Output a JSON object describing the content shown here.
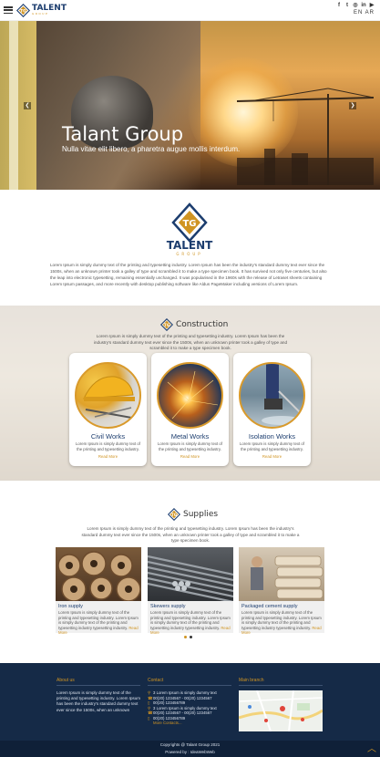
{
  "header": {
    "brand": "TALENT",
    "brand_sub": "GROUP",
    "social_icons": [
      "facebook-icon",
      "twitter-icon",
      "instagram-icon",
      "linkedin-icon",
      "youtube-icon"
    ],
    "languages": [
      "EN",
      "AR"
    ]
  },
  "hero": {
    "title": "Talant Group",
    "subtitle": "Nulla vitae elit libero, a pharetra augue mollis interdum."
  },
  "about": {
    "brand": "TALENT",
    "brand_sub": "GROUP",
    "text": "Lorem Ipsum is simply dummy text of the printing and typesetting industry. Lorem Ipsum has been the industry's standard dummy text ever since the 1500s, when an unknown printer took a galley of type and scrambled it to make a type specimen book. It has survived not only five centuries, but also the leap into electronic typesetting, remaining essentially unchanged. It was popularised in the 1960s with the release of Letraset sheets containing Lorem Ipsum passages, and more recently with desktop publishing software like Aldus PageMaker including versions of Lorem Ipsum."
  },
  "construction": {
    "title": "Construction",
    "desc": "Lorem Ipsum is simply dummy text of the printing and typesetting industry. Lorem Ipsum has been the industry's standard dummy text ever since the 1500s, when an unknown printer took a galley of type and scrambled it to make a type specimen book.",
    "cards": [
      {
        "title": "Civil Works",
        "desc": "Lorem Ipsum is simply dummy text of the printing and typesetting industry.",
        "more": "Read More"
      },
      {
        "title": "Metal Works",
        "desc": "Lorem Ipsum is simply dummy text of the printing and typesetting industry.",
        "more": "Read More"
      },
      {
        "title": "Isolation Works",
        "desc": "Lorem Ipsum is simply dummy text of the printing and typesetting industry.",
        "more": "Read More"
      }
    ]
  },
  "supplies": {
    "title": "Supplies",
    "desc": "Lorem Ipsum is simply dummy text of the printing and typesetting industry. Lorem Ipsum has been the industry's standard dummy text ever since the 1500s, when an unknown printer took a galley of type and scrambled it to make a type specimen book.",
    "items": [
      {
        "title": "Iron supply",
        "desc": "Lorem Ipsum is simply dummy text of the printing and typesetting industry. Lorem Ipsum is simply dummy text of the printing and typesetting industry typesetting industry.",
        "more": "Read More"
      },
      {
        "title": "Skewers supply",
        "desc": "Lorem Ipsum is simply dummy text of the printing and typesetting industry. Lorem Ipsum is simply dummy text of the printing and typesetting industry typesetting industry.",
        "more": "Read More"
      },
      {
        "title": "Packaged cement supply",
        "desc": "Lorem Ipsum is simply dummy text of the printing and typesetting industry. Lorem Ipsum is simply dummy text of the printing and typesetting industry typesetting industry.",
        "more": "Read More"
      }
    ]
  },
  "footer": {
    "about_head": "About us",
    "about_text": "Lorem Ipsum is simply dummy text of the printing and typesetting industry. Lorem Ipsum has been the industry's standard dummy text ever since the 1500s, when an unknown",
    "contact_head": "Contact",
    "contacts": [
      {
        "icon": "map-pin-icon",
        "text": "3 Lorem Ipsum is simply dummy text"
      },
      {
        "icon": "phone-icon",
        "text": "00(20) 1234567 - 00(20) 1234567"
      },
      {
        "icon": "mobile-icon",
        "text": "00(20) 123456789"
      },
      {
        "icon": "map-pin-icon",
        "text": "3 Lorem Ipsum is simply dummy text"
      },
      {
        "icon": "phone-icon",
        "text": "00(20) 1234567 - 00(20) 1234567"
      },
      {
        "icon": "mobile-icon",
        "text": "00(20) 123456789"
      }
    ],
    "more_contacts": "More Contacts...",
    "map_head": "Main branch",
    "copyright": "Copyrights @ Talant Group 2021",
    "powered": "Powered by : IdeaWebWeb"
  }
}
